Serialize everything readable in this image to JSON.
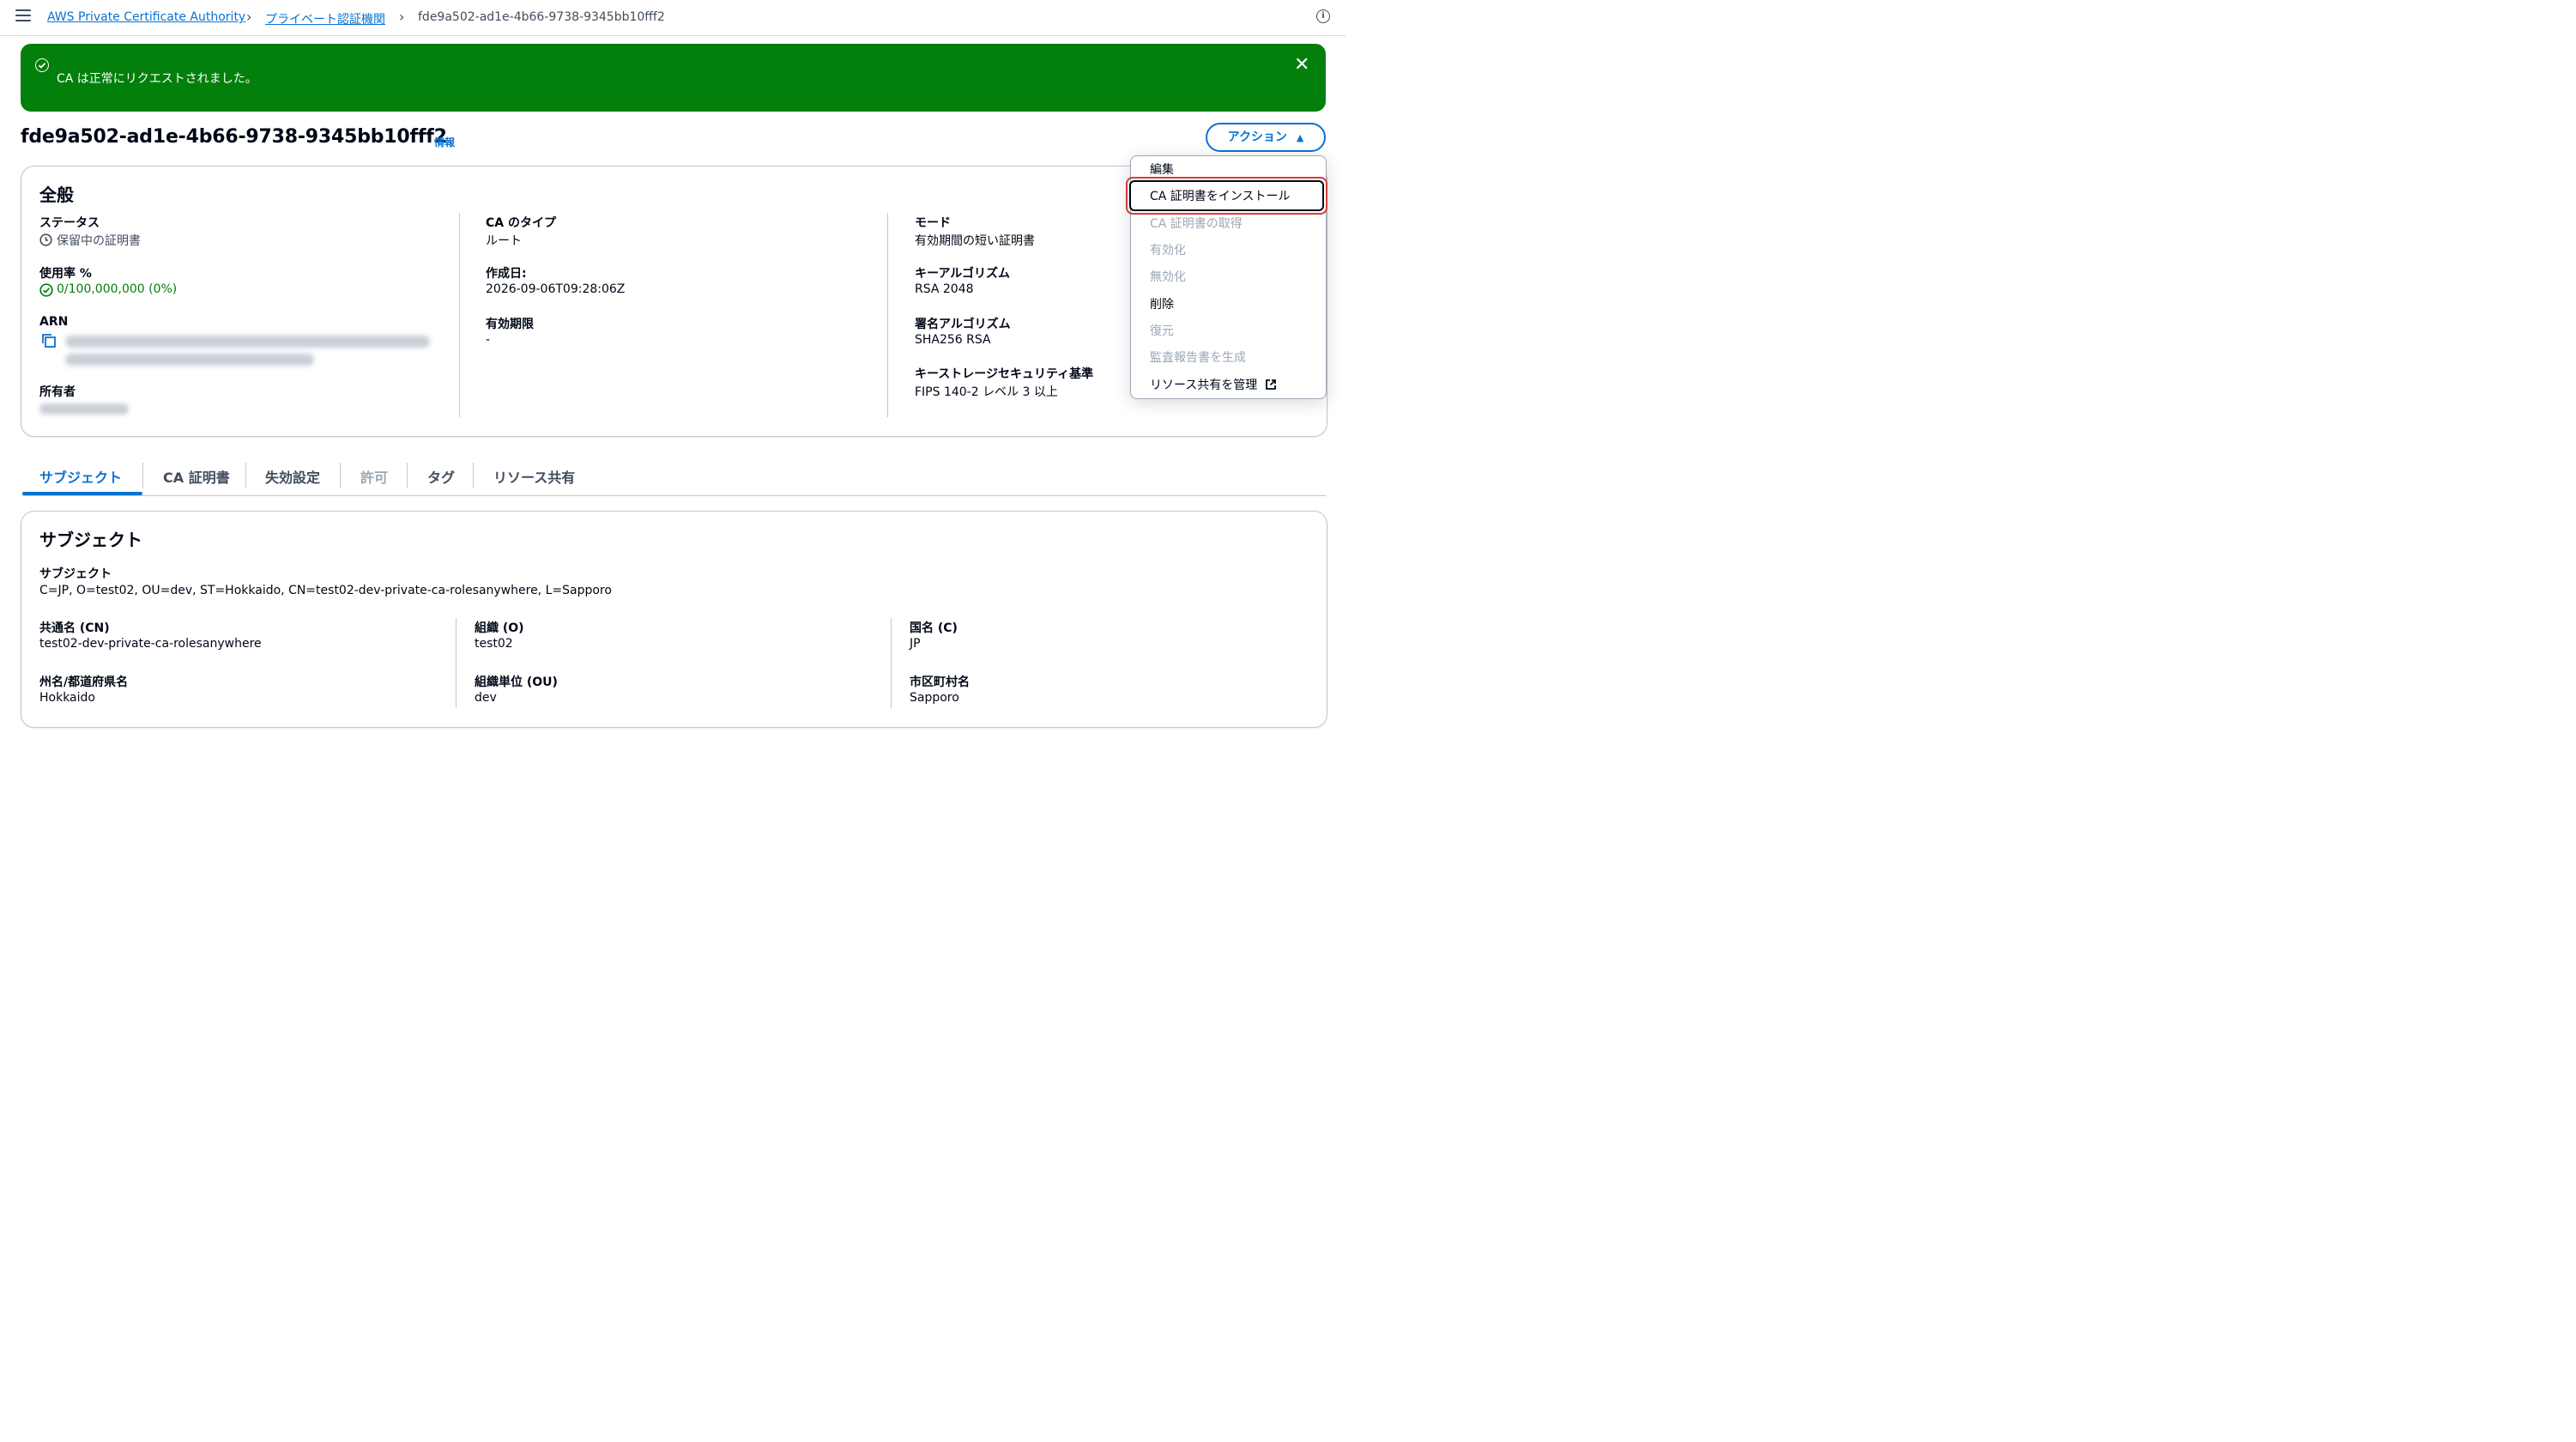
{
  "breadcrumb": {
    "items": [
      "AWS Private Certificate Authority",
      "プライベート認証機関"
    ],
    "current": "fde9a502-ad1e-4b66-9738-9345bb10fff2"
  },
  "flash": {
    "message": "CA は正常にリクエストされました。",
    "color": "#037f0c"
  },
  "page": {
    "title": "fde9a502-ad1e-4b66-9738-9345bb10fff2",
    "info_link": "情報",
    "actions_label": "アクション"
  },
  "general": {
    "heading": "全般",
    "status_label": "ステータス",
    "status_value": "保留中の証明書",
    "usage_label": "使用率 %",
    "usage_value": "0/100,000,000 (0%)",
    "arn_label": "ARN",
    "owner_label": "所有者",
    "ca_type_label": "CA のタイプ",
    "ca_type_value": "ルート",
    "created_label": "作成日:",
    "created_value": "2026-09-06T09:28:06Z",
    "expiry_label": "有効期限",
    "expiry_value": "-",
    "mode_label": "モード",
    "mode_value": "有効期間の短い証明書",
    "key_algo_label": "キーアルゴリズム",
    "key_algo_value": "RSA 2048",
    "sign_algo_label": "署名アルゴリズム",
    "sign_algo_value": "SHA256 RSA",
    "key_storage_label": "キーストレージセキュリティ基準",
    "key_storage_value": "FIPS 140-2 レベル 3 以上"
  },
  "menu": {
    "items": [
      {
        "label": "編集"
      },
      {
        "label": "CA 証明書をインストール"
      },
      {
        "label": "CA 証明書の取得"
      },
      {
        "label": "有効化"
      },
      {
        "label": "無効化"
      },
      {
        "label": "削除"
      },
      {
        "label": "復元"
      },
      {
        "label": "監査報告書を生成"
      },
      {
        "label": "リソース共有を管理"
      }
    ]
  },
  "tabs": [
    "サブジェクト",
    "CA 証明書",
    "失効設定",
    "許可",
    "タグ",
    "リソース共有"
  ],
  "subject": {
    "heading": "サブジェクト",
    "subject_label": "サブジェクト",
    "subject_value": "C=JP, O=test02, OU=dev, ST=Hokkaido, CN=test02-dev-private-ca-rolesanywhere, L=Sapporo",
    "cn_label": "共通名 (CN)",
    "cn_value": "test02-dev-private-ca-rolesanywhere",
    "o_label": "組織 (O)",
    "o_value": "test02",
    "c_label": "国名 (C)",
    "c_value": "JP",
    "st_label": "州名/都道府県名",
    "st_value": "Hokkaido",
    "ou_label": "組織単位 (OU)",
    "ou_value": "dev",
    "l_label": "市区町村名",
    "l_value": "Sapporo"
  }
}
